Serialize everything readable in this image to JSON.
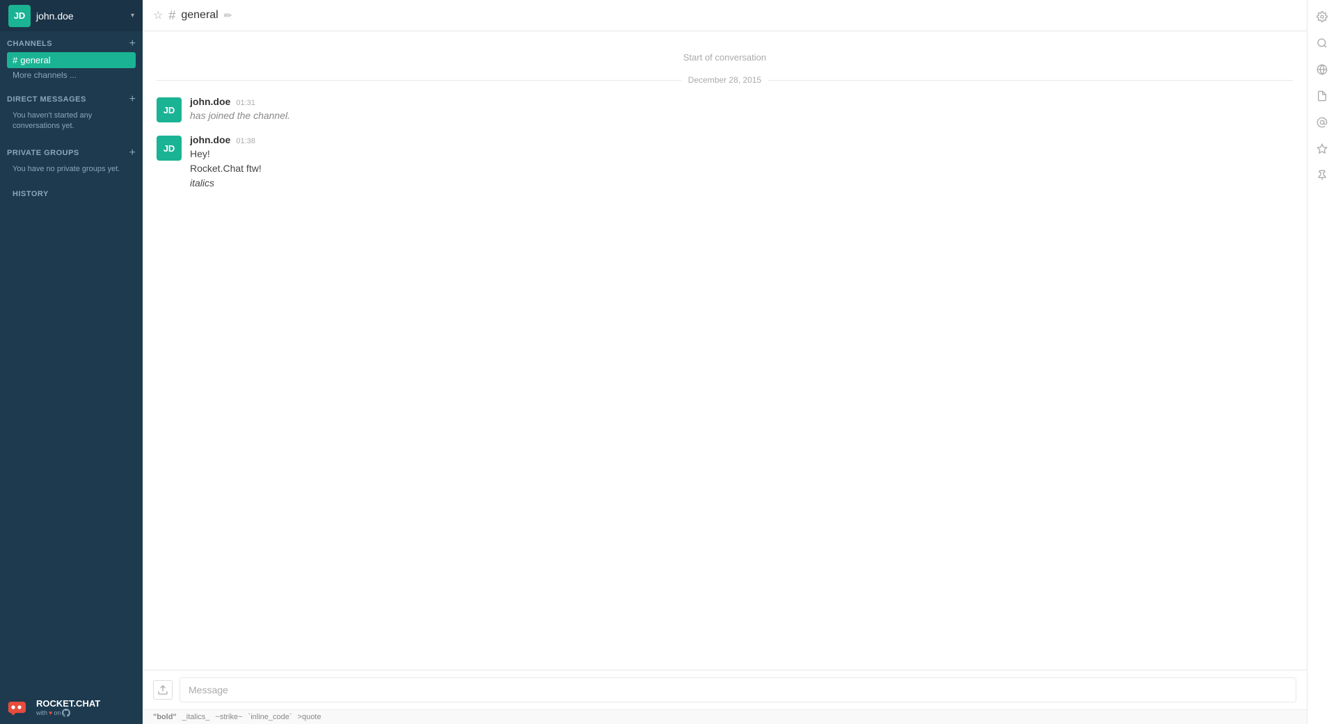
{
  "sidebar": {
    "user": {
      "initials": "JD",
      "name": "john.doe"
    },
    "channels_section": {
      "title": "CHANNELS",
      "add_label": "+",
      "items": [
        {
          "name": "general",
          "active": true
        }
      ],
      "more_channels_label": "More channels ..."
    },
    "direct_messages_section": {
      "title": "DIRECT MESSAGES",
      "add_label": "+",
      "empty_text": "You haven't started any conversations yet."
    },
    "private_groups_section": {
      "title": "PRIVATE GROUPS",
      "add_label": "+",
      "empty_text": "You have no private groups yet."
    },
    "history_label": "HISTORY",
    "footer": {
      "logo_text": "ROCKET.CHAT",
      "sub_text_prefix": "with",
      "sub_text_suffix": "on"
    }
  },
  "topbar": {
    "channel_name": "general",
    "hash_symbol": "#"
  },
  "chat": {
    "start_label": "Start of conversation",
    "date_divider": "December 28, 2015",
    "messages": [
      {
        "user": "john.doe",
        "initials": "JD",
        "time": "01:31",
        "text": "has joined the channel.",
        "style": "system"
      },
      {
        "user": "john.doe",
        "initials": "JD",
        "time": "01:38",
        "lines": [
          "Hey!",
          "Rocket.Chat ftw!",
          "italics"
        ],
        "italic_line": 2
      }
    ]
  },
  "input": {
    "placeholder": "Message",
    "format_hints": [
      {
        "label": "\"bold\"",
        "style": "bold"
      },
      {
        "label": "_italics_",
        "style": "normal"
      },
      {
        "label": "~strike~",
        "style": "normal"
      },
      {
        "label": "`inline_code`",
        "style": "normal"
      },
      {
        "label": ">quote",
        "style": "normal"
      }
    ]
  },
  "right_sidebar": {
    "icons": [
      {
        "name": "gear-icon",
        "symbol": "⚙"
      },
      {
        "name": "search-icon",
        "symbol": "🔍"
      },
      {
        "name": "globe-icon",
        "symbol": "🌐"
      },
      {
        "name": "file-icon",
        "symbol": "📄"
      },
      {
        "name": "at-icon",
        "symbol": "@"
      },
      {
        "name": "star-icon",
        "symbol": "★"
      },
      {
        "name": "pin-icon",
        "symbol": "📌"
      }
    ]
  }
}
